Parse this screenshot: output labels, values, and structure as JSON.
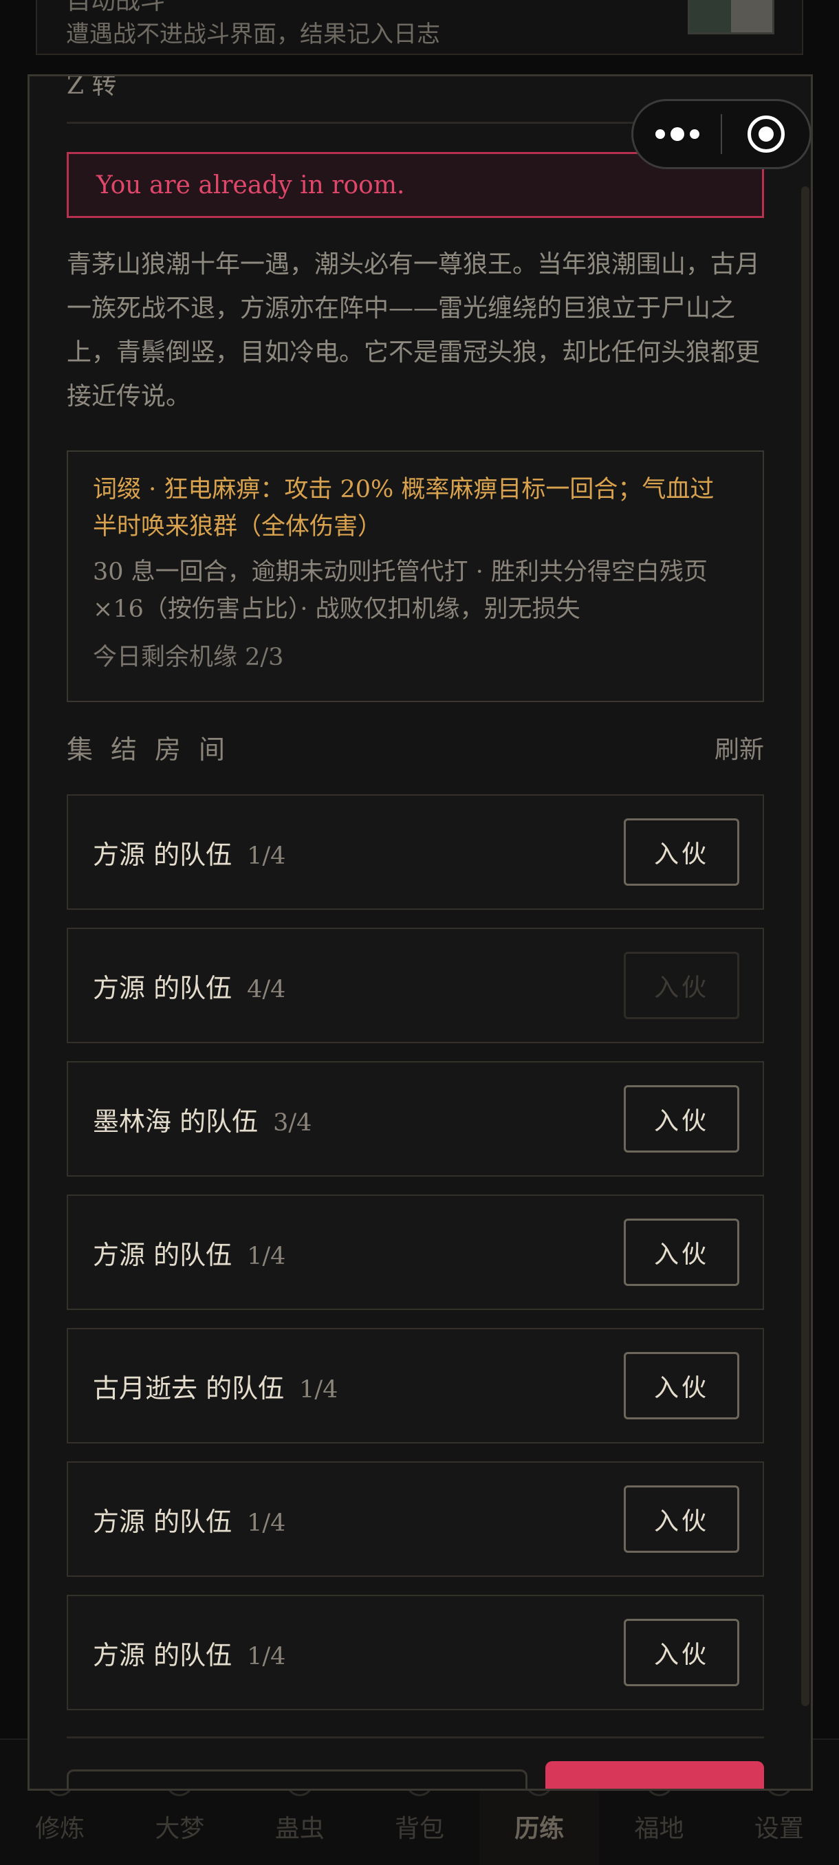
{
  "background": {
    "card_title": "自动战斗",
    "card_subtitle": "遭遇战不进战斗界面，结果记入日志"
  },
  "modal": {
    "prev_line": "Z 转",
    "alert_text": "You are already in room.",
    "description": "青茅山狼潮十年一遇，潮头必有一尊狼王。当年狼潮围山，古月一族死战不退，方源亦在阵中——雷光缠绕的巨狼立于尸山之上，青鬃倒竖，目如冷电。它不是雷冠头狼，却比任何头狼都更接近传说。",
    "info": {
      "affix": "词缀 · 狂电麻痹：攻击 20% 概率麻痹目标一回合；气血过半时唤来狼群（全体伤害）",
      "rule": "30 息一回合，逾期未动则托管代打 · 胜利共分得空白残页 ×16（按伤害占比）· 战败仅扣机缘，别无损失",
      "remaining": "今日剩余机缘 2/3"
    },
    "section_title": "集结房间",
    "refresh_label": "刷新",
    "join_label": "入伙",
    "rooms": [
      {
        "name": "方源 的队伍",
        "count": "1/4",
        "full": false
      },
      {
        "name": "方源 的队伍",
        "count": "4/4",
        "full": true
      },
      {
        "name": "墨林海 的队伍",
        "count": "3/4",
        "full": false
      },
      {
        "name": "方源 的队伍",
        "count": "1/4",
        "full": false
      },
      {
        "name": "古月逝去 的队伍",
        "count": "1/4",
        "full": false
      },
      {
        "name": "方源 的队伍",
        "count": "1/4",
        "full": false
      },
      {
        "name": "方源 的队伍",
        "count": "1/4",
        "full": false
      }
    ]
  },
  "tabbar": {
    "tabs": [
      "修炼",
      "大梦",
      "蛊虫",
      "背包",
      "历练",
      "福地",
      "设置"
    ],
    "active": "历练"
  },
  "colors": {
    "accent_pink": "#d8375a",
    "alert_text": "#e0476b",
    "affix_gold": "#d9a24f"
  }
}
